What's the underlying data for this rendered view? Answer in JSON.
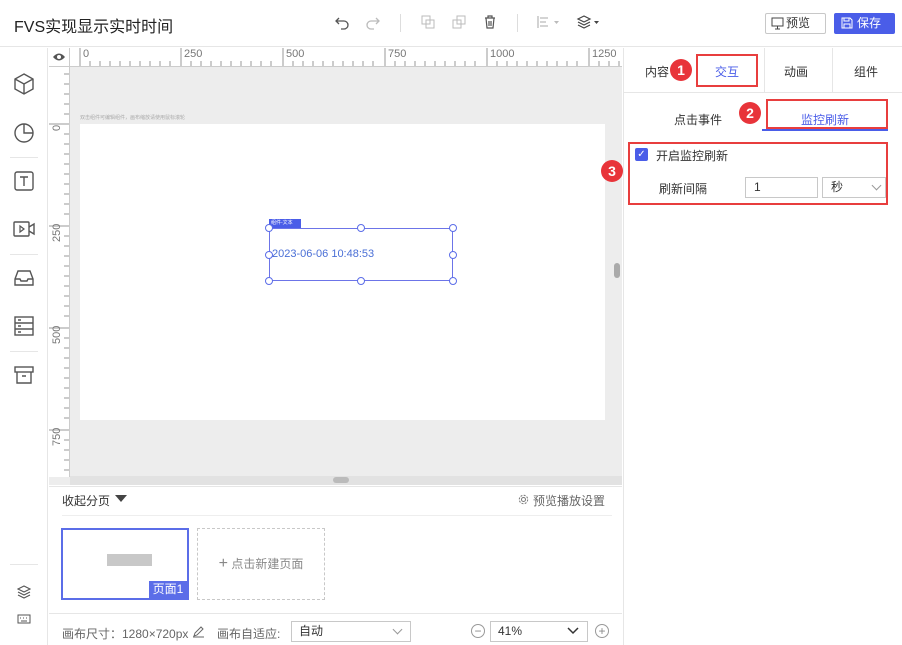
{
  "app": {
    "title": "FVS实现显示实时时间"
  },
  "toolbar": {
    "icons": [
      "undo-icon",
      "redo-icon",
      "bring-forward-icon",
      "send-backward-icon",
      "trash-icon",
      "align-icon",
      "layers-icon"
    ],
    "preview_label": "预览",
    "save_label": "保存"
  },
  "sidebar": {
    "items": [
      "cube-icon",
      "pie-chart-icon",
      "text-icon",
      "video-icon",
      "inbox-icon",
      "server-icon",
      "archive-icon",
      "layers-icon",
      "keyboard-icon"
    ]
  },
  "ruler": {
    "top_labels": [
      "0",
      "250",
      "500",
      "750",
      "1000",
      "1250"
    ],
    "left_labels": [
      "0",
      "250",
      "500",
      "750"
    ]
  },
  "canvas": {
    "hint": "双击组件可编辑组件，画布缩放请使用鼠标滚轮",
    "widget_tag": "组件-文本",
    "widget_text": "2023-06-06 10:48:53"
  },
  "pages": {
    "collapse_label": "收起分页",
    "play_settings": "预览播放设置",
    "page_label": "页面1",
    "new_page_label": "点击新建页面"
  },
  "bottom": {
    "canvas_size": "画布尺寸：1280×720px",
    "auto_fit_label": "画布自适应:",
    "auto_fit_value": "自动",
    "zoom_value": "41%"
  },
  "right_panel": {
    "tabs": [
      "内容",
      "交互",
      "动画",
      "组件"
    ],
    "sub_tabs": [
      "点击事件",
      "监控刷新"
    ],
    "enable_monitor_label": "开启监控刷新",
    "interval_label": "刷新间隔",
    "interval_value": "1",
    "unit_value": "秒"
  },
  "annotations": [
    "1",
    "2",
    "3"
  ],
  "colors": {
    "accent": "#4a5de8",
    "annotation_red": "#e83e3e"
  }
}
